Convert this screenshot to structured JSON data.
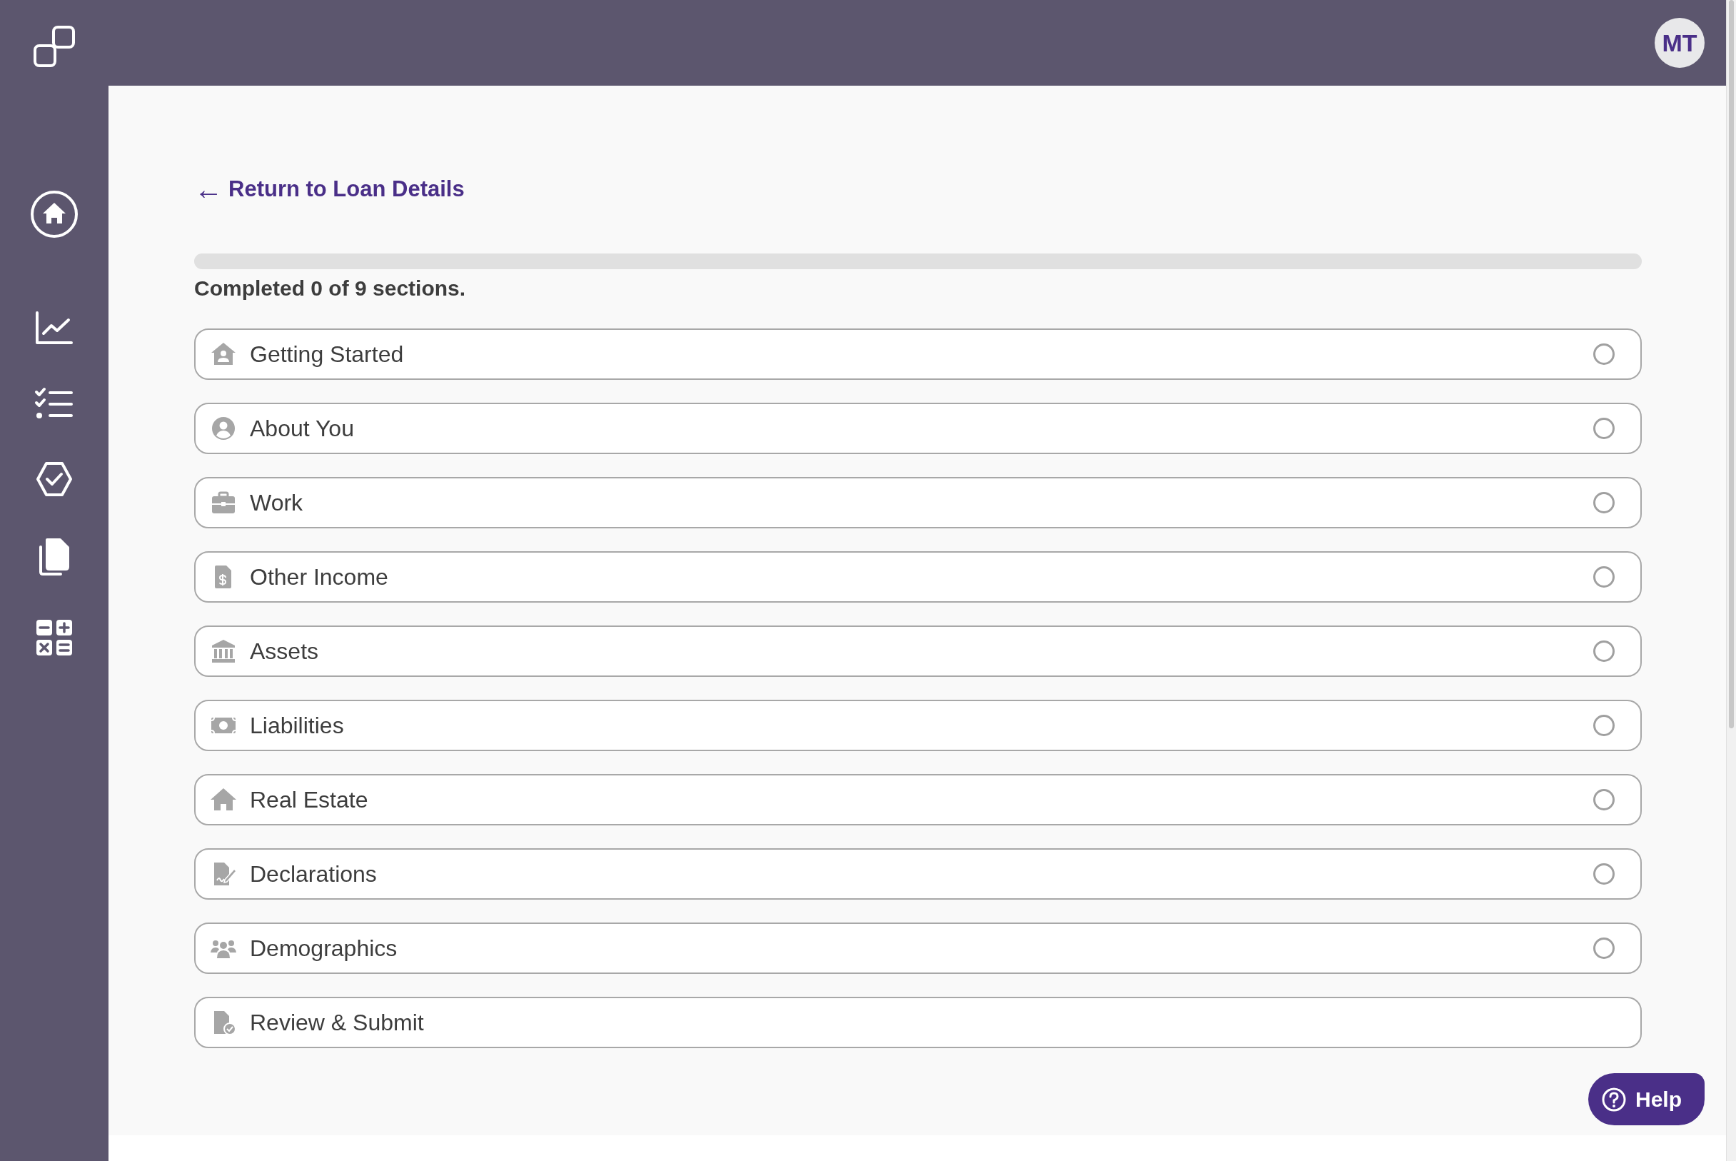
{
  "header": {
    "avatar_initials": "MT"
  },
  "back_link": {
    "arrow": "←",
    "label": "Return to Loan Details"
  },
  "progress": {
    "level": 0,
    "summary": "Completed 0 of 9 sections."
  },
  "sections": [
    {
      "label": "Getting Started",
      "kind": "section",
      "completed": false
    },
    {
      "label": "About You",
      "kind": "section",
      "completed": false
    },
    {
      "label": "Work",
      "kind": "section",
      "completed": false
    },
    {
      "label": "Other Income",
      "kind": "section",
      "completed": false
    },
    {
      "label": "Assets",
      "kind": "section",
      "completed": false
    },
    {
      "label": "Liabilities",
      "kind": "section",
      "completed": false
    },
    {
      "label": "Real Estate",
      "kind": "section",
      "completed": false
    },
    {
      "label": "Declarations",
      "kind": "section",
      "completed": false
    },
    {
      "label": "Demographics",
      "kind": "section",
      "completed": false
    },
    {
      "label": "Review & Submit",
      "kind": "submit"
    }
  ],
  "help_button": {
    "label": "Help"
  }
}
